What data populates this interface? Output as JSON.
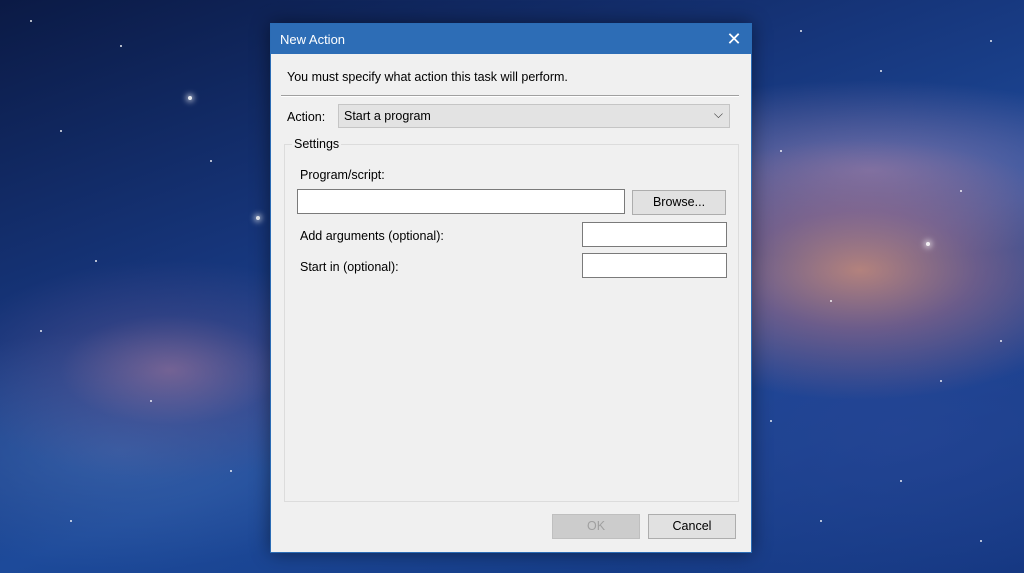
{
  "dialog": {
    "title": "New Action",
    "close_icon": "close-icon",
    "instruction": "You must specify what action this task will perform.",
    "action_label": "Action:",
    "action_value": "Start a program",
    "settings_label": "Settings",
    "program_label": "Program/script:",
    "program_value": "",
    "browse_label": "Browse...",
    "arguments_label": "Add arguments (optional):",
    "arguments_value": "",
    "startin_label": "Start in (optional):",
    "startin_value": "",
    "ok_label": "OK",
    "cancel_label": "Cancel"
  },
  "colors": {
    "titlebar": "#2d6db6",
    "dialog_bg": "#f0f0f0"
  }
}
